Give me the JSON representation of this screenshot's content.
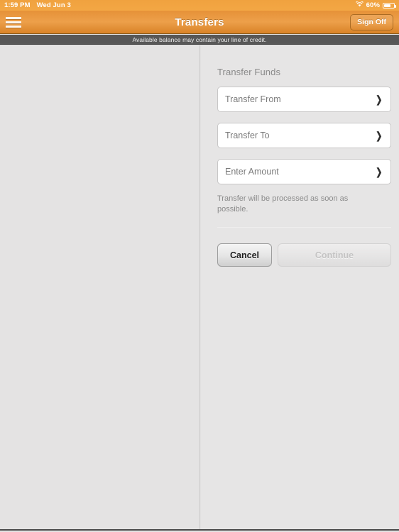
{
  "status_bar": {
    "time": "1:59 PM",
    "date": "Wed Jun 3",
    "wifi_icon": "wifi-icon",
    "battery_percent": "60%",
    "battery_icon": "battery-icon",
    "battery_level": 60
  },
  "nav_bar": {
    "menu_icon": "hamburger-menu-icon",
    "title": "Transfers",
    "sign_off_label": "Sign Off",
    "background_color": "#e69138"
  },
  "notice_bar": {
    "text": "Available balance may contain your line of credit.",
    "background_color": "#575757"
  },
  "panes": {
    "left_background": "#e4e3e3",
    "right_background": "#e6e5e5",
    "divider_color": "#c9c8c8"
  },
  "form": {
    "section_title": "Transfer Funds",
    "fields": [
      {
        "label": "Transfer From",
        "value": "",
        "placeholder": "Transfer From",
        "chevron": "chevron-right-icon",
        "name": "transfer-from-field"
      },
      {
        "label": "Transfer To",
        "value": "",
        "placeholder": "Transfer To",
        "chevron": "chevron-right-icon",
        "name": "transfer-to-field"
      },
      {
        "label": "Enter Amount",
        "value": "",
        "placeholder": "Enter Amount",
        "chevron": "chevron-right-icon",
        "name": "enter-amount-field"
      }
    ],
    "helper_text": "Transfer will be processed as soon as possible.",
    "buttons": {
      "cancel_label": "Cancel",
      "continue_label": "Continue",
      "continue_disabled": true
    }
  }
}
